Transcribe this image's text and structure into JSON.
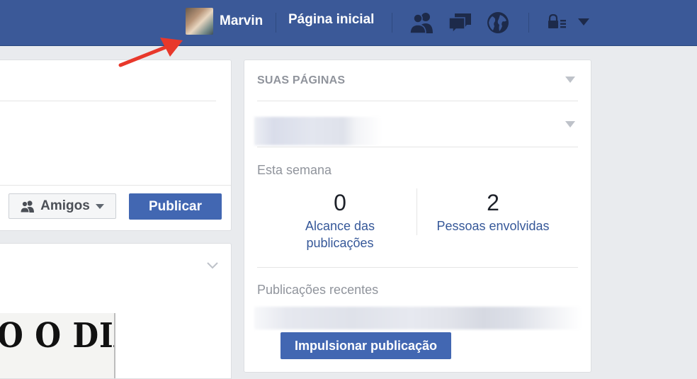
{
  "topbar": {
    "profile_name": "Marvin",
    "home_label": "Página inicial",
    "icons": [
      "friends-icon",
      "messages-icon",
      "globe-icon",
      "lock-menu-icon",
      "caret-down-icon"
    ],
    "colors": {
      "bar": "#3b5998",
      "text": "#ffffff"
    }
  },
  "composer": {
    "audience_label": "Amigos",
    "publish_label": "Publicar"
  },
  "post": {
    "headline_text": "O O DIA!"
  },
  "pages_panel": {
    "header": "SUAS PÁGINAS",
    "week_label": "Esta semana",
    "stats": [
      {
        "value": "0",
        "label_line1": "Alcance das",
        "label_line2": "publicações"
      },
      {
        "value": "2",
        "label_line1": "Pessoas envolvidas",
        "label_line2": ""
      }
    ],
    "recent_label": "Publicações recentes",
    "boost_label": "Impulsionar publicação"
  },
  "colors": {
    "accent": "#4267b2",
    "link": "#365899",
    "muted": "#90949c",
    "annotation_arrow": "#e8382b"
  }
}
